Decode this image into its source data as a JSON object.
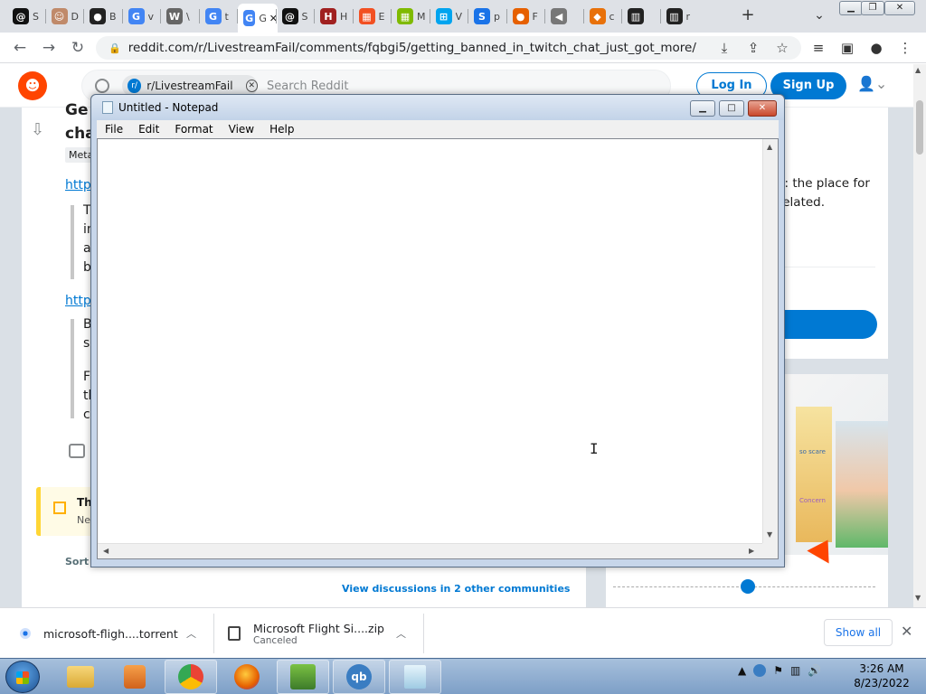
{
  "browser": {
    "tabs": [
      {
        "favicon": "threads-icon",
        "title": "S",
        "color": "#111111",
        "glyph": "@"
      },
      {
        "favicon": "face-icon",
        "title": "D",
        "color": "#c08a6a",
        "glyph": "☺"
      },
      {
        "favicon": "steam-icon",
        "title": "B",
        "color": "#222222",
        "glyph": "●"
      },
      {
        "favicon": "google-icon",
        "title": "v",
        "color": "#4285f4",
        "glyph": "G"
      },
      {
        "favicon": "wiki-icon",
        "title": "\\",
        "color": "#666666",
        "glyph": "W"
      },
      {
        "favicon": "google-icon",
        "title": "t",
        "color": "#4285f4",
        "glyph": "G"
      },
      {
        "favicon": "google-icon",
        "title": "G",
        "color": "#4285f4",
        "glyph": "G"
      },
      {
        "favicon": "threads-icon",
        "title": "S",
        "color": "#111111",
        "glyph": "@"
      },
      {
        "favicon": "hfs-icon",
        "title": "H",
        "color": "#a02020",
        "glyph": "H"
      },
      {
        "favicon": "microsoft-icon",
        "title": "E",
        "color": "#f25022",
        "glyph": "▦"
      },
      {
        "favicon": "microsoft-icon",
        "title": "M",
        "color": "#7fba00",
        "glyph": "▦"
      },
      {
        "favicon": "windows-icon",
        "title": "V",
        "color": "#00a4ef",
        "glyph": "⊞"
      },
      {
        "favicon": "skype-icon",
        "title": "p",
        "color": "#1a73e8",
        "glyph": "S"
      },
      {
        "favicon": "firefox-icon",
        "title": "F",
        "color": "#e66000",
        "glyph": "●"
      },
      {
        "favicon": "audio-icon",
        "title": "",
        "color": "#777777",
        "glyph": "◀"
      },
      {
        "favicon": "diamond-icon",
        "title": "c",
        "color": "#e8710a",
        "glyph": "◆"
      },
      {
        "favicon": "museum-icon",
        "title": "",
        "color": "#222222",
        "glyph": "▥"
      },
      {
        "favicon": "museum-icon",
        "title": "r",
        "color": "#222222",
        "glyph": "▥"
      }
    ],
    "active_tab_index": 6,
    "url": "reddit.com/r/LivestreamFail/comments/fqbgi5/getting_banned_in_twitch_chat_just_got_more/"
  },
  "reddit": {
    "logo_glyph": "☻",
    "subreddit_chip": "r/LivestreamFail",
    "search_placeholder": "Search Reddit",
    "login_label": "Log In",
    "signup_label": "Sign Up",
    "post": {
      "title_fragment_1": "Ge",
      "title_fragment_2": "cha",
      "flair": "Meta",
      "link_1": "http",
      "quote1_lines": [
        "T",
        "in",
        "a",
        "b"
      ],
      "link_2": "http",
      "quote2_lines": [
        "B",
        "s"
      ],
      "quote3_lines": [
        "F",
        "th",
        "c"
      ],
      "notice_title": "Th",
      "notice_body": "Ne",
      "sort_label": "Sort b",
      "view_discussions": "View discussions in 2 other communities"
    },
    "sidebar": {
      "about_line1": "il: the place for",
      "about_line2": "related."
    },
    "ad": {
      "caption1": "so scare",
      "caption2": "Concern"
    }
  },
  "notepad": {
    "title": "Untitled - Notepad",
    "menu": [
      "File",
      "Edit",
      "Format",
      "View",
      "Help"
    ],
    "content": ""
  },
  "downloads": {
    "items": [
      {
        "name": "microsoft-fligh....torrent",
        "status": ""
      },
      {
        "name": "Microsoft Flight Si....zip",
        "status": "Canceled"
      }
    ],
    "show_all_label": "Show all"
  },
  "taskbar": {
    "time": "3:26 AM",
    "date": "8/23/2022"
  }
}
